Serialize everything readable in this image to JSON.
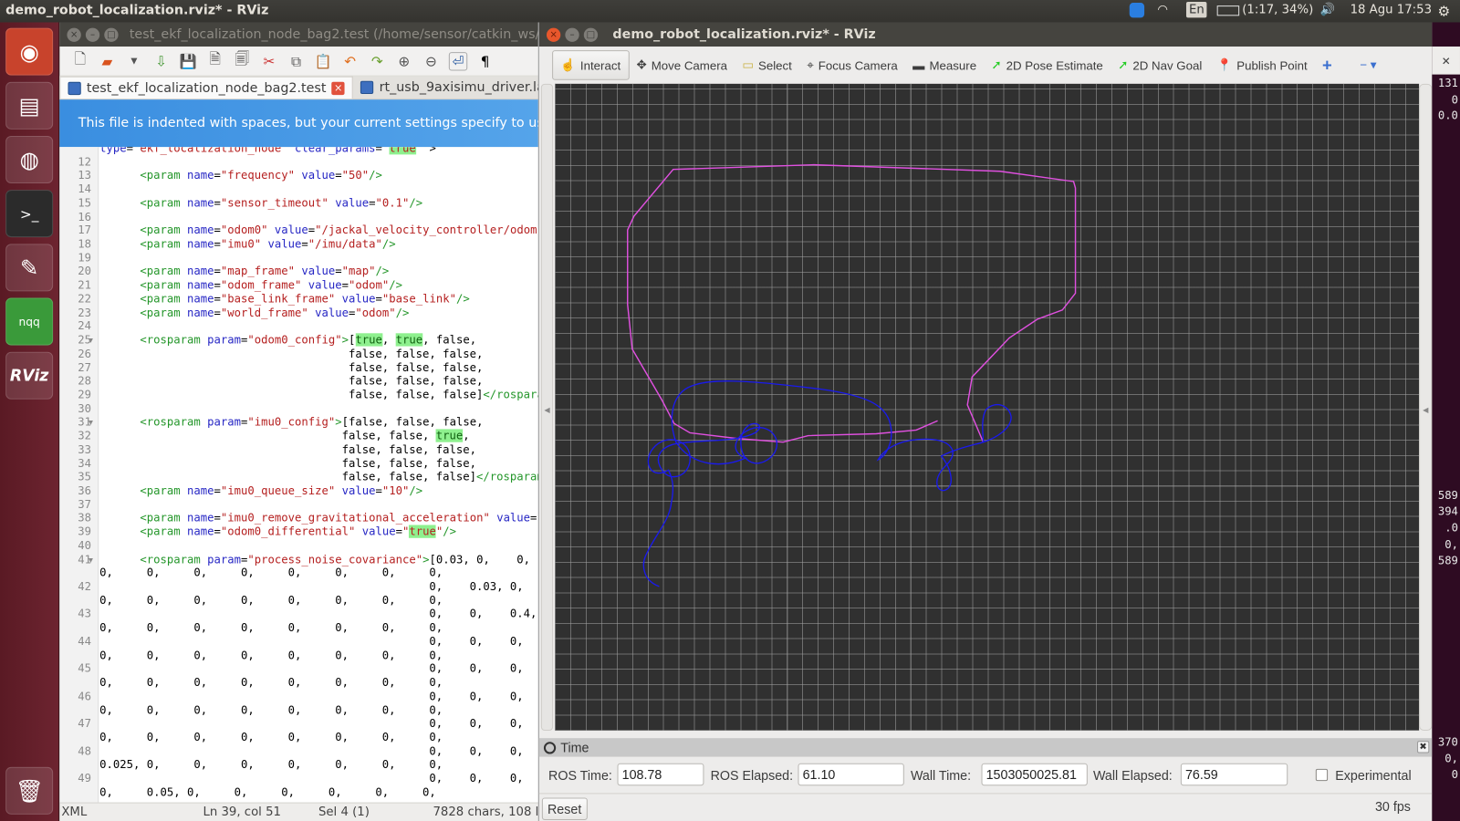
{
  "topbar": {
    "title": "demo_robot_localization.rviz* - RViz",
    "keyboard": "En",
    "battery": "(1:17, 34%)",
    "clock": "18 Agu 17:53",
    "icons": [
      "teamviewer-icon",
      "wifi-icon",
      "battery-icon",
      "volume-icon",
      "gear-icon"
    ]
  },
  "launcher": {
    "items": [
      {
        "name": "ubuntu-dash",
        "glyph": "◉"
      },
      {
        "name": "files",
        "glyph": "▤"
      },
      {
        "name": "firefox",
        "glyph": "◍"
      },
      {
        "name": "terminal",
        "glyph": ">_"
      },
      {
        "name": "text-editor",
        "glyph": "✎"
      },
      {
        "name": "notepadqq",
        "glyph": "nqq"
      },
      {
        "name": "rviz",
        "glyph": "RViz"
      },
      {
        "name": "trash",
        "glyph": "🗑"
      }
    ]
  },
  "gedit": {
    "title": "test_ekf_localization_node_bag2.test (/home/sensor/catkin_ws/",
    "tabs": [
      {
        "label": "test_ekf_localization_node_bag2.test",
        "active": true
      },
      {
        "label": "rt_usb_9axisimu_driver.la",
        "active": false
      }
    ],
    "infobar": "This file is indented with spaces, but your current settings specify to use tabs.",
    "status": {
      "lang": "XML",
      "position": "Ln 39, col 51",
      "selection": "Sel 4 (1)",
      "chars": "7828 chars, 108 l"
    },
    "rows": [
      {
        "n": "",
        "s": [
          [
            "b",
            "type"
          ],
          [
            "",
            "="
          ],
          [
            "r",
            "\"ekf_localization_node\""
          ],
          [
            "",
            " "
          ],
          [
            "b",
            "clear_params"
          ],
          [
            "",
            "="
          ],
          [
            "r",
            "\""
          ],
          [
            "h",
            "true"
          ],
          [
            "r",
            "\""
          ],
          [
            "",
            " >"
          ]
        ]
      },
      {
        "n": "12",
        "s": []
      },
      {
        "n": "13",
        "s": [
          [
            "",
            "      "
          ],
          [
            "g",
            "<param"
          ],
          [
            "",
            " "
          ],
          [
            "b",
            "name"
          ],
          [
            "",
            "="
          ],
          [
            "r",
            "\"frequency\""
          ],
          [
            "",
            " "
          ],
          [
            "b",
            "value"
          ],
          [
            "",
            "="
          ],
          [
            "r",
            "\"50\""
          ],
          [
            "g",
            "/>"
          ]
        ]
      },
      {
        "n": "14",
        "s": []
      },
      {
        "n": "15",
        "s": [
          [
            "",
            "      "
          ],
          [
            "g",
            "<param"
          ],
          [
            "",
            " "
          ],
          [
            "b",
            "name"
          ],
          [
            "",
            "="
          ],
          [
            "r",
            "\"sensor_timeout\""
          ],
          [
            "",
            " "
          ],
          [
            "b",
            "value"
          ],
          [
            "",
            "="
          ],
          [
            "r",
            "\"0.1\""
          ],
          [
            "g",
            "/>"
          ]
        ]
      },
      {
        "n": "16",
        "s": []
      },
      {
        "n": "17",
        "s": [
          [
            "",
            "      "
          ],
          [
            "g",
            "<param"
          ],
          [
            "",
            " "
          ],
          [
            "b",
            "name"
          ],
          [
            "",
            "="
          ],
          [
            "r",
            "\"odom0\""
          ],
          [
            "",
            " "
          ],
          [
            "b",
            "value"
          ],
          [
            "",
            "="
          ],
          [
            "r",
            "\"/jackal_velocity_controller/odom\""
          ],
          [
            "g",
            "/>"
          ]
        ]
      },
      {
        "n": "18",
        "s": [
          [
            "",
            "      "
          ],
          [
            "g",
            "<param"
          ],
          [
            "",
            " "
          ],
          [
            "b",
            "name"
          ],
          [
            "",
            "="
          ],
          [
            "r",
            "\"imu0\""
          ],
          [
            "",
            " "
          ],
          [
            "b",
            "value"
          ],
          [
            "",
            "="
          ],
          [
            "r",
            "\"/imu/data\""
          ],
          [
            "g",
            "/>"
          ]
        ]
      },
      {
        "n": "19",
        "s": []
      },
      {
        "n": "20",
        "s": [
          [
            "",
            "      "
          ],
          [
            "g",
            "<param"
          ],
          [
            "",
            " "
          ],
          [
            "b",
            "name"
          ],
          [
            "",
            "="
          ],
          [
            "r",
            "\"map_frame\""
          ],
          [
            "",
            " "
          ],
          [
            "b",
            "value"
          ],
          [
            "",
            "="
          ],
          [
            "r",
            "\"map\""
          ],
          [
            "g",
            "/>"
          ]
        ]
      },
      {
        "n": "21",
        "s": [
          [
            "",
            "      "
          ],
          [
            "g",
            "<param"
          ],
          [
            "",
            " "
          ],
          [
            "b",
            "name"
          ],
          [
            "",
            "="
          ],
          [
            "r",
            "\"odom_frame\""
          ],
          [
            "",
            " "
          ],
          [
            "b",
            "value"
          ],
          [
            "",
            "="
          ],
          [
            "r",
            "\"odom\""
          ],
          [
            "g",
            "/>"
          ]
        ]
      },
      {
        "n": "22",
        "s": [
          [
            "",
            "      "
          ],
          [
            "g",
            "<param"
          ],
          [
            "",
            " "
          ],
          [
            "b",
            "name"
          ],
          [
            "",
            "="
          ],
          [
            "r",
            "\"base_link_frame\""
          ],
          [
            "",
            " "
          ],
          [
            "b",
            "value"
          ],
          [
            "",
            "="
          ],
          [
            "r",
            "\"base_link\""
          ],
          [
            "g",
            "/>"
          ]
        ]
      },
      {
        "n": "23",
        "s": [
          [
            "",
            "      "
          ],
          [
            "g",
            "<param"
          ],
          [
            "",
            " "
          ],
          [
            "b",
            "name"
          ],
          [
            "",
            "="
          ],
          [
            "r",
            "\"world_frame\""
          ],
          [
            "",
            " "
          ],
          [
            "b",
            "value"
          ],
          [
            "",
            "="
          ],
          [
            "r",
            "\"odom\""
          ],
          [
            "g",
            "/>"
          ]
        ]
      },
      {
        "n": "24",
        "s": []
      },
      {
        "n": "25",
        "f": true,
        "s": [
          [
            "",
            "      "
          ],
          [
            "g",
            "<rosparam"
          ],
          [
            "",
            " "
          ],
          [
            "b",
            "param"
          ],
          [
            "",
            "="
          ],
          [
            "r",
            "\"odom0_config\""
          ],
          [
            "g",
            ">"
          ],
          [
            "",
            "["
          ],
          [
            "hb",
            "true"
          ],
          [
            "",
            ", "
          ],
          [
            "hb",
            "true"
          ],
          [
            "",
            ", false,"
          ]
        ]
      },
      {
        "n": "26",
        "s": [
          [
            "",
            "                                     false, false, false,"
          ]
        ]
      },
      {
        "n": "27",
        "s": [
          [
            "",
            "                                     false, false, false,"
          ]
        ]
      },
      {
        "n": "28",
        "s": [
          [
            "",
            "                                     false, false, false,"
          ]
        ]
      },
      {
        "n": "29",
        "s": [
          [
            "",
            "                                     false, false, false]"
          ],
          [
            "g",
            "</rosparam>"
          ]
        ]
      },
      {
        "n": "30",
        "s": []
      },
      {
        "n": "31",
        "f": true,
        "s": [
          [
            "",
            "      "
          ],
          [
            "g",
            "<rosparam"
          ],
          [
            "",
            " "
          ],
          [
            "b",
            "param"
          ],
          [
            "",
            "="
          ],
          [
            "r",
            "\"imu0_config\""
          ],
          [
            "g",
            ">"
          ],
          [
            "",
            "[false, false, false,"
          ]
        ]
      },
      {
        "n": "32",
        "s": [
          [
            "",
            "                                    false, false, "
          ],
          [
            "hb",
            "true"
          ],
          [
            "",
            ","
          ]
        ]
      },
      {
        "n": "33",
        "s": [
          [
            "",
            "                                    false, false, false,"
          ]
        ]
      },
      {
        "n": "34",
        "s": [
          [
            "",
            "                                    false, false, false,"
          ]
        ]
      },
      {
        "n": "35",
        "s": [
          [
            "",
            "                                    false, false, false]"
          ],
          [
            "g",
            "</rosparam>"
          ]
        ]
      },
      {
        "n": "36",
        "s": [
          [
            "",
            "      "
          ],
          [
            "g",
            "<param"
          ],
          [
            "",
            " "
          ],
          [
            "b",
            "name"
          ],
          [
            "",
            "="
          ],
          [
            "r",
            "\"imu0_queue_size\""
          ],
          [
            "",
            " "
          ],
          [
            "b",
            "value"
          ],
          [
            "",
            "="
          ],
          [
            "r",
            "\"10\""
          ],
          [
            "g",
            "/>"
          ]
        ]
      },
      {
        "n": "37",
        "s": []
      },
      {
        "n": "38",
        "s": [
          [
            "",
            "      "
          ],
          [
            "g",
            "<param"
          ],
          [
            "",
            " "
          ],
          [
            "b",
            "name"
          ],
          [
            "",
            "="
          ],
          [
            "r",
            "\"imu0_remove_gravitational_acceleration\""
          ],
          [
            "",
            " "
          ],
          [
            "b",
            "value"
          ],
          [
            "",
            "="
          ],
          [
            "r",
            "\"t"
          ]
        ]
      },
      {
        "n": "39",
        "s": [
          [
            "",
            "      "
          ],
          [
            "g",
            "<param"
          ],
          [
            "",
            " "
          ],
          [
            "b",
            "name"
          ],
          [
            "",
            "="
          ],
          [
            "r",
            "\"odom0_differential\""
          ],
          [
            "",
            " "
          ],
          [
            "b",
            "value"
          ],
          [
            "",
            "="
          ],
          [
            "r",
            "\""
          ],
          [
            "h",
            "true"
          ],
          [
            "r",
            "\""
          ],
          [
            "g",
            "/>"
          ]
        ]
      },
      {
        "n": "40",
        "s": []
      },
      {
        "n": "41",
        "f": true,
        "s": [
          [
            "",
            "      "
          ],
          [
            "g",
            "<rosparam"
          ],
          [
            "",
            " "
          ],
          [
            "b",
            "param"
          ],
          [
            "",
            "="
          ],
          [
            "r",
            "\"process_noise_covariance\""
          ],
          [
            "g",
            ">"
          ],
          [
            "",
            "[0.03, 0,    0,"
          ]
        ]
      },
      {
        "n": "",
        "s": [
          [
            "",
            "0,     0,     0,     0,     0,     0,     0,     0,"
          ]
        ]
      },
      {
        "n": "42",
        "s": [
          [
            "",
            "                                                 0,    0.03, 0,"
          ]
        ]
      },
      {
        "n": "",
        "s": [
          [
            "",
            "0,     0,     0,     0,     0,     0,     0,     0,"
          ]
        ]
      },
      {
        "n": "43",
        "s": [
          [
            "",
            "                                                 0,    0,    0.4,"
          ]
        ]
      },
      {
        "n": "",
        "s": [
          [
            "",
            "0,     0,     0,     0,     0,     0,     0,     0,"
          ]
        ]
      },
      {
        "n": "44",
        "s": [
          [
            "",
            "                                                 0,    0,    0,"
          ]
        ]
      },
      {
        "n": "",
        "s": [
          [
            "",
            "0,     0,     0,     0,     0,     0,     0,     0,"
          ]
        ]
      },
      {
        "n": "45",
        "s": [
          [
            "",
            "                                                 0,    0,    0,"
          ]
        ]
      },
      {
        "n": "",
        "s": [
          [
            "",
            "0,     0,     0,     0,     0,     0,     0,     0,"
          ]
        ]
      },
      {
        "n": "46",
        "s": [
          [
            "",
            "                                                 0,    0,    0,"
          ]
        ]
      },
      {
        "n": "",
        "s": [
          [
            "",
            "0,     0,     0,     0,     0,     0,     0,     0,"
          ]
        ]
      },
      {
        "n": "47",
        "s": [
          [
            "",
            "                                                 0,    0,    0,"
          ]
        ]
      },
      {
        "n": "",
        "s": [
          [
            "",
            "0,     0,     0,     0,     0,     0,     0,     0,"
          ]
        ]
      },
      {
        "n": "48",
        "s": [
          [
            "",
            "                                                 0,    0,    0,"
          ]
        ]
      },
      {
        "n": "",
        "s": [
          [
            "",
            "0.025, 0,     0,     0,     0,     0,     0,     0,"
          ]
        ]
      },
      {
        "n": "49",
        "s": [
          [
            "",
            "                                                 0,    0,    0,"
          ]
        ]
      },
      {
        "n": "",
        "s": [
          [
            "",
            "0,     0.05, 0,     0,     0,     0,     0,     0,"
          ]
        ]
      }
    ]
  },
  "rviz": {
    "title": "demo_robot_localization.rviz* - RViz",
    "tools": [
      {
        "label": "Interact",
        "icon": "hand-icon",
        "glyph": "☝",
        "active": true
      },
      {
        "label": "Move Camera",
        "icon": "move-camera-icon",
        "glyph": "✥"
      },
      {
        "label": "Select",
        "icon": "select-icon",
        "glyph": "▭"
      },
      {
        "label": "Focus Camera",
        "icon": "focus-camera-icon",
        "glyph": "⌖"
      },
      {
        "label": "Measure",
        "icon": "ruler-icon",
        "glyph": "▬"
      },
      {
        "label": "2D Pose Estimate",
        "icon": "green-arrow-icon",
        "glyph": "➚"
      },
      {
        "label": "2D Nav Goal",
        "icon": "green-arrow-icon",
        "glyph": "➚"
      },
      {
        "label": "Publish Point",
        "icon": "map-pin-icon",
        "glyph": "📍"
      }
    ],
    "add_tool_glyph": "+",
    "remove_tool_glyph": "−",
    "colors": {
      "ekf_path": "#e050e0",
      "odom_path": "#1a1aee",
      "grid": "#a0a0a0",
      "background": "#303030"
    },
    "time_panel": {
      "title": "Time",
      "ros_time_label": "ROS Time:",
      "ros_time": "108.78",
      "ros_elapsed_label": "ROS Elapsed:",
      "ros_elapsed": "61.10",
      "wall_time_label": "Wall Time:",
      "wall_time": "1503050025.81",
      "wall_elapsed_label": "Wall Elapsed:",
      "wall_elapsed": "76.59",
      "experimental_label": "Experimental",
      "experimental_checked": false
    },
    "reset_label": "Reset",
    "fps": "30 fps"
  },
  "terminal": {
    "lines": [
      {
        "t": "131",
        "row": 0
      },
      {
        "t": "0",
        "row": 1
      },
      {
        "t": "0.0",
        "row": 2
      },
      {
        "t": "589",
        "row": 25
      },
      {
        "t": "394",
        "row": 26
      },
      {
        "t": ".0",
        "row": 27
      },
      {
        "t": "0,",
        "row": 28
      },
      {
        "t": "589",
        "row": 29
      },
      {
        "t": "370",
        "row": 40
      },
      {
        "t": "0,",
        "row": 41
      },
      {
        "t": "0",
        "row": 42
      }
    ]
  }
}
